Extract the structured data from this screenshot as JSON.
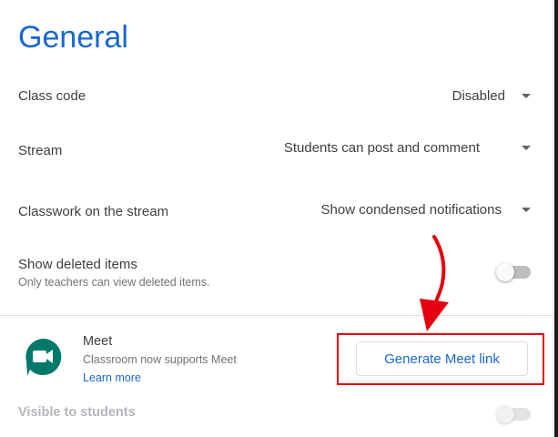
{
  "section": {
    "title": "General"
  },
  "settings": {
    "class_code": {
      "label": "Class code",
      "value": "Disabled"
    },
    "stream": {
      "label": "Stream",
      "value": "Students can post and comment"
    },
    "classwork": {
      "label": "Classwork on the stream",
      "value": "Show condensed notifications"
    },
    "deleted": {
      "label": "Show deleted items",
      "sub": "Only teachers can view deleted items.",
      "enabled": false
    }
  },
  "meet": {
    "title": "Meet",
    "sub": "Classroom now supports Meet",
    "learn_more": "Learn more",
    "button": "Generate Meet link",
    "visible_label": "Visible to students",
    "visible_enabled": false
  },
  "colors": {
    "accent": "#1967d2",
    "highlight": "#e5000f",
    "meet_green": "#00796b"
  },
  "annotations": {
    "arrow_color": "#e5000f",
    "highlight_box_color": "#e5000f"
  }
}
